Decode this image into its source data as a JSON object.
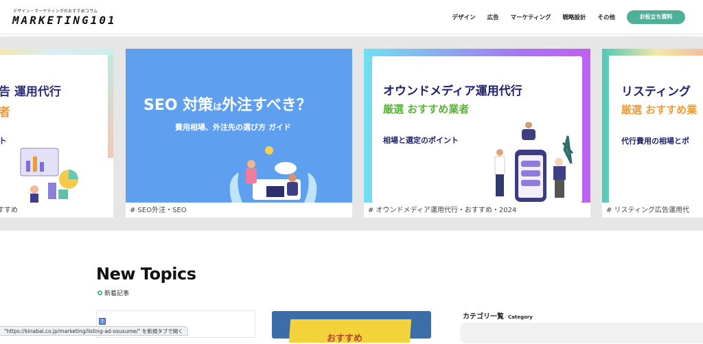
{
  "header": {
    "tagline": "デザイン・マーケティングのおすすめコラム",
    "logo": "MARKETING101",
    "nav": [
      "デザイン",
      "広告",
      "マーケティング",
      "戦略設計",
      "その他"
    ],
    "cta": "お役立ち資料"
  },
  "colors": {
    "accent": "#4fb09a",
    "slide_blue": "#5f9fef",
    "navy": "#1d1f6b",
    "green": "#5ab33a",
    "orange": "#ef9b33"
  },
  "slides": [
    {
      "title1": "告 運用代行",
      "title2": "者",
      "line3": "ト",
      "tag": "すすめ"
    },
    {
      "title_a": "SEO 対策",
      "title_small": "は",
      "title_b": "外注すべき？",
      "subtitle": "費用相場、外注先の選び方 ガイド",
      "tag": "# SEO外注・SEO"
    },
    {
      "title1": "オウンドメディア運用代行",
      "title2": "厳選 おすすめ業者",
      "subtitle": "相場と選定のポイント",
      "tag": "# オウンドメディア運用代行・おすすめ・2024"
    },
    {
      "title1": "リスティング",
      "title2": "厳選 おすすめ業",
      "subtitle": "代行費用の相場とポ",
      "tag": "# リスティング広告運用代"
    }
  ],
  "section": {
    "title": "New Topics",
    "subtitle": "新着記事"
  },
  "card_yellow_text": "おすすめ",
  "sidebar": {
    "title": "カテゴリ一覧",
    "title_en": "Category"
  },
  "status": "\"https://kinabal.co.jp/marketing/listing-ad-osusume/\" を新規タブで開く"
}
